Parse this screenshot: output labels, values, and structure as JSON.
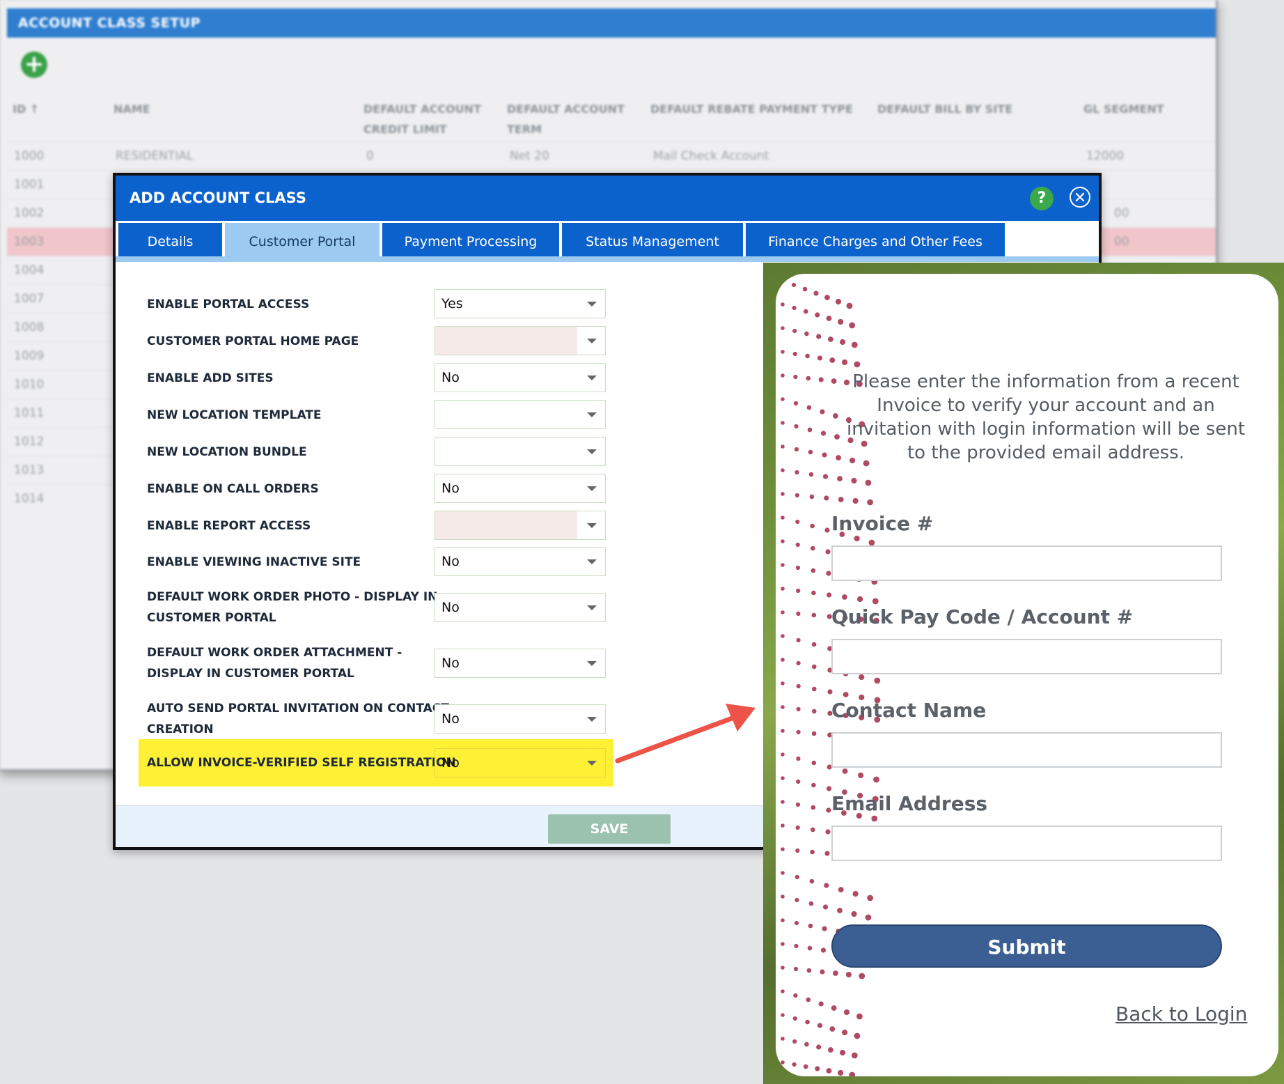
{
  "background": {
    "title": "ACCOUNT CLASS SETUP",
    "add_icon": "plus-circle-icon",
    "columns": [
      "ID ↑",
      "NAME",
      "DEFAULT ACCOUNT CREDIT LIMIT",
      "DEFAULT ACCOUNT TERM",
      "DEFAULT REBATE PAYMENT TYPE",
      "DEFAULT BILL BY SITE",
      "GL SEGMENT"
    ],
    "rows": [
      {
        "id": "1000",
        "name": "RESIDENTIAL",
        "credit": "0",
        "term": "Net 20",
        "rebate": "Mail Check Account",
        "gl": "12000"
      },
      {
        "id": "1001"
      },
      {
        "id": "1002",
        "gl": "00"
      },
      {
        "id": "1003",
        "gl": "00"
      },
      {
        "id": "1004"
      },
      {
        "id": "1007"
      },
      {
        "id": "1008"
      },
      {
        "id": "1009"
      },
      {
        "id": "1010"
      },
      {
        "id": "1011"
      },
      {
        "id": "1012"
      },
      {
        "id": "1013"
      },
      {
        "id": "1014"
      }
    ],
    "selected_row_color": "#f0c6ca"
  },
  "modal": {
    "title": "ADD ACCOUNT CLASS",
    "tabs": [
      "Details",
      "Customer Portal",
      "Payment Processing",
      "Status Management",
      "Finance Charges and Other Fees"
    ],
    "active_tab": "Customer Portal",
    "fields": [
      {
        "label": "ENABLE PORTAL ACCESS",
        "value": "Yes"
      },
      {
        "label": "CUSTOMER PORTAL HOME PAGE",
        "value": ""
      },
      {
        "label": "ENABLE ADD SITES",
        "value": "No"
      },
      {
        "label": "NEW LOCATION TEMPLATE",
        "value": ""
      },
      {
        "label": "NEW LOCATION BUNDLE",
        "value": ""
      },
      {
        "label": "ENABLE ON CALL ORDERS",
        "value": "No"
      },
      {
        "label": "ENABLE REPORT ACCESS",
        "value": ""
      },
      {
        "label": "ENABLE VIEWING INACTIVE SITE",
        "value": "No"
      },
      {
        "label": "DEFAULT WORK ORDER PHOTO - DISPLAY IN",
        "label2": "CUSTOMER PORTAL",
        "value": "No"
      },
      {
        "label": "DEFAULT WORK ORDER ATTACHMENT -",
        "label2": "DISPLAY IN CUSTOMER PORTAL",
        "value": "No"
      },
      {
        "label": "AUTO SEND PORTAL INVITATION ON CONTACT",
        "label2": "CREATION",
        "value": "No"
      },
      {
        "label": "ALLOW INVOICE-VERIFIED SELF REGISTRATION",
        "value": "No"
      }
    ],
    "save_label": "SAVE",
    "highlight_color": "#fdf035"
  },
  "portal": {
    "intro": "Please enter the information from a recent Invoice to verify your account and an invitation with login information will be sent to the provided email address.",
    "fields": [
      {
        "label": "Invoice #",
        "value": ""
      },
      {
        "label": "Quick Pay Code / Account #",
        "value": ""
      },
      {
        "label": "Contact Name",
        "value": ""
      },
      {
        "label": "Email Address",
        "value": ""
      }
    ],
    "submit_label": "Submit",
    "back_link": "Back to Login"
  },
  "colors": {
    "brand_blue": "#0c62cc",
    "tab_active": "#9ccaf0",
    "submit": "#3c5f93",
    "arrow": "#ee5348",
    "help_green": "#3ba94a"
  }
}
